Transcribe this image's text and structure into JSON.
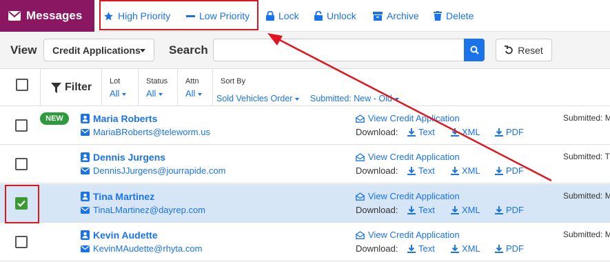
{
  "app": {
    "title": "Messages"
  },
  "toolbar": {
    "high_priority": "High Priority",
    "low_priority": "Low Priority",
    "lock": "Lock",
    "unlock": "Unlock",
    "archive": "Archive",
    "delete": "Delete"
  },
  "viewbar": {
    "view_label": "View",
    "view_value": "Credit Applications",
    "search_label": "Search",
    "search_value": "",
    "reset_label": "Reset"
  },
  "header": {
    "filter": "Filter",
    "lot": {
      "label": "Lot",
      "value": "All"
    },
    "status": {
      "label": "Status",
      "value": "All"
    },
    "attn": {
      "label": "Attn",
      "value": "All"
    },
    "sort_by": {
      "label": "Sort By",
      "primary": "Sold Vehicles Order",
      "secondary": "Submitted: New - Old"
    }
  },
  "rows": [
    {
      "badge": "NEW",
      "name": "Maria Roberts",
      "email": "MariaBRoberts@teleworm.us",
      "checked": false,
      "submitted": "Submitted: M"
    },
    {
      "badge": "",
      "name": "Dennis Jurgens",
      "email": "DennisJJurgens@jourrapide.com",
      "checked": false,
      "submitted": "Submitted: T"
    },
    {
      "badge": "",
      "name": "Tina Martinez",
      "email": "TinaLMartinez@dayrep.com",
      "checked": true,
      "submitted": "Submitted: M"
    },
    {
      "badge": "",
      "name": "Kevin Audette",
      "email": "KevinMAudette@rhyta.com",
      "checked": false,
      "submitted": "Submitted: M"
    }
  ],
  "row_labels": {
    "view_credit_app": "View Credit Application",
    "download": "Download:",
    "text": "Text",
    "xml": "XML",
    "pdf": "PDF"
  },
  "colors": {
    "brand": "#8a1761",
    "accent": "#1a73e8",
    "highlight": "#e0141e",
    "selected_row": "#d7e6f6",
    "new_badge": "#2e9b3b"
  }
}
